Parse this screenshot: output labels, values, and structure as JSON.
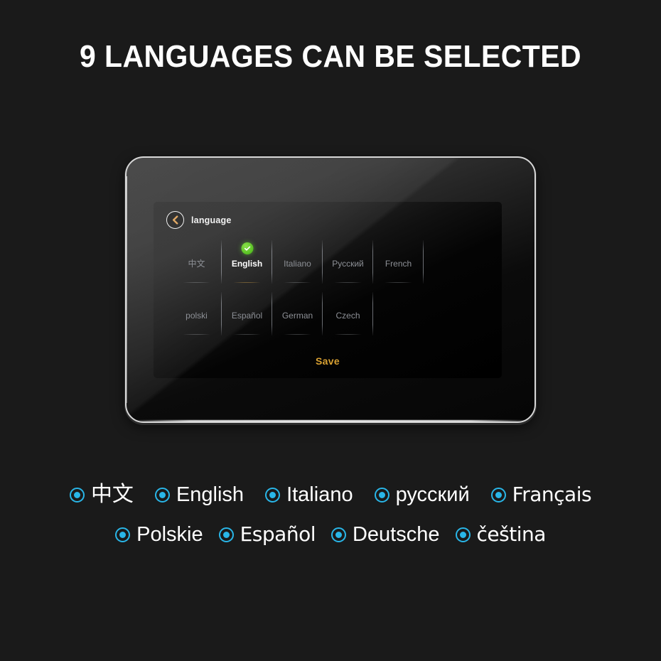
{
  "headline": "9 LANGUAGES CAN BE SELECTED",
  "colors": {
    "page_background": "#1a1a1a",
    "accent_cyan": "#29b6e8",
    "save_gold": "#d9a132",
    "check_green": "#57c022",
    "back_chevron": "#e0a258",
    "frame_silver": "#d8d8d8"
  },
  "device": {
    "screen": {
      "header": {
        "back_icon": "chevron-left-icon",
        "title": "language"
      },
      "grid": {
        "rows": [
          [
            {
              "label": "中文",
              "selected": false
            },
            {
              "label": "English",
              "selected": true
            },
            {
              "label": "Italiano",
              "selected": false
            },
            {
              "label": "Русский",
              "selected": false
            },
            {
              "label": "French",
              "selected": false
            }
          ],
          [
            {
              "label": "polski",
              "selected": false
            },
            {
              "label": "Español",
              "selected": false
            },
            {
              "label": "German",
              "selected": false
            },
            {
              "label": "Czech",
              "selected": false
            },
            {
              "label": "",
              "selected": false
            }
          ]
        ],
        "selected_badge_icon": "check-circle-icon"
      },
      "save_label": "Save"
    }
  },
  "legend": {
    "rows": [
      [
        {
          "label": "中文",
          "style": "cjk"
        },
        {
          "label": "English",
          "style": "normal"
        },
        {
          "label": "Italiano",
          "style": "normal"
        },
        {
          "label": "русский",
          "style": "normal"
        },
        {
          "label": "Français",
          "style": "wide"
        }
      ],
      [
        {
          "label": "Polskie",
          "style": "normal"
        },
        {
          "label": "Español",
          "style": "wide"
        },
        {
          "label": "Deutsche",
          "style": "normal"
        },
        {
          "label": "čeština",
          "style": "wide"
        }
      ]
    ]
  }
}
